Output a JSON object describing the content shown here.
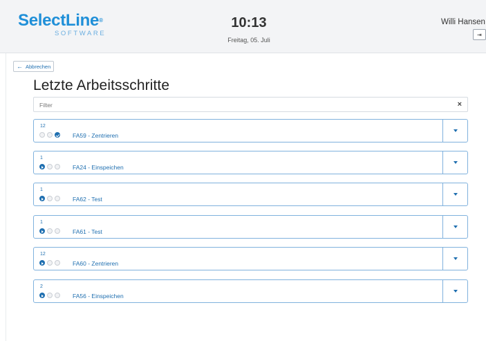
{
  "header": {
    "logo_main": "SelectLine",
    "logo_reg": "®",
    "logo_sub": "SOFTWARE",
    "time": "10:13",
    "date": "Freitag, 05. Juli",
    "user": "Willi Hansen",
    "logout_icon": "⇥"
  },
  "toolbar": {
    "cancel_arrow": "←",
    "cancel_label": "Abbrechen"
  },
  "page": {
    "title": "Letzte Arbeitsschritte"
  },
  "filter": {
    "placeholder": "Filter",
    "clear": "×"
  },
  "colors": {
    "accent": "#1f6fb0",
    "logo": "#1f8fd8",
    "card_border": "#7fb1dd"
  },
  "steps": [
    {
      "count": "12",
      "label": "FA59 - Zentrieren",
      "status": [
        "pending",
        "pending",
        "done"
      ]
    },
    {
      "count": "1",
      "label": "FA24 - Einspeichen",
      "status": [
        "active",
        "pending",
        "pending"
      ]
    },
    {
      "count": "1",
      "label": "FA62 - Test",
      "status": [
        "active",
        "pending",
        "pending"
      ]
    },
    {
      "count": "1",
      "label": "FA61 - Test",
      "status": [
        "active",
        "pending",
        "pending"
      ]
    },
    {
      "count": "12",
      "label": "FA60 - Zentrieren",
      "status": [
        "active",
        "pending",
        "pending"
      ]
    },
    {
      "count": "2",
      "label": "FA56 - Einspeichen",
      "status": [
        "active",
        "pending",
        "pending"
      ]
    }
  ]
}
